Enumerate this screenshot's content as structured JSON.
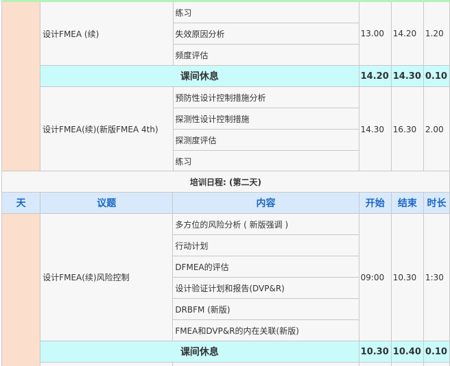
{
  "block1": {
    "topic": "设计FMEA (续)",
    "items": [
      "练习",
      "失效原因分析",
      "频度评估"
    ],
    "start": "13.00",
    "end": "14.20",
    "duration": "1.20"
  },
  "break1": {
    "label": "课间休息",
    "start": "14.20",
    "end": "14.30",
    "duration": "0.10"
  },
  "block2": {
    "topic": "设计FMEA(续)(新版FMEA 4th)",
    "items": [
      "预防性设计控制措施分析",
      "探测性设计控制措施",
      "探测度评估",
      "练习"
    ],
    "start": "14.30",
    "end": "16.30",
    "duration": "2.00"
  },
  "day2": {
    "section_title": "培训日程: (第二天)"
  },
  "headers": {
    "day": "天",
    "topic": "议题",
    "content": "内容",
    "start": "开始",
    "end": "结束",
    "duration": "时长"
  },
  "block3": {
    "topic": "设计FMEA(续)风险控制",
    "items": [
      "多方位的风险分析 ( 新版强调 )",
      "行动计划",
      "DFMEA的评估",
      "设计验证计划和报告(DVP&R)",
      "DRBFM (新版)",
      "FMEA和DVP&R的内在关联(新版)"
    ],
    "start": "09:00",
    "end": "10.30",
    "duration": "1:30"
  },
  "break2": {
    "label": "课间休息",
    "start": "10.30",
    "end": "10.40",
    "duration": "0.10"
  },
  "colors": {
    "day_cell": "#fbdfcc",
    "break_row": "#c9fbfb",
    "header_row": "#d8e9fb",
    "header_text": "#1a67c4",
    "top_strip": "#b6f1b6"
  }
}
